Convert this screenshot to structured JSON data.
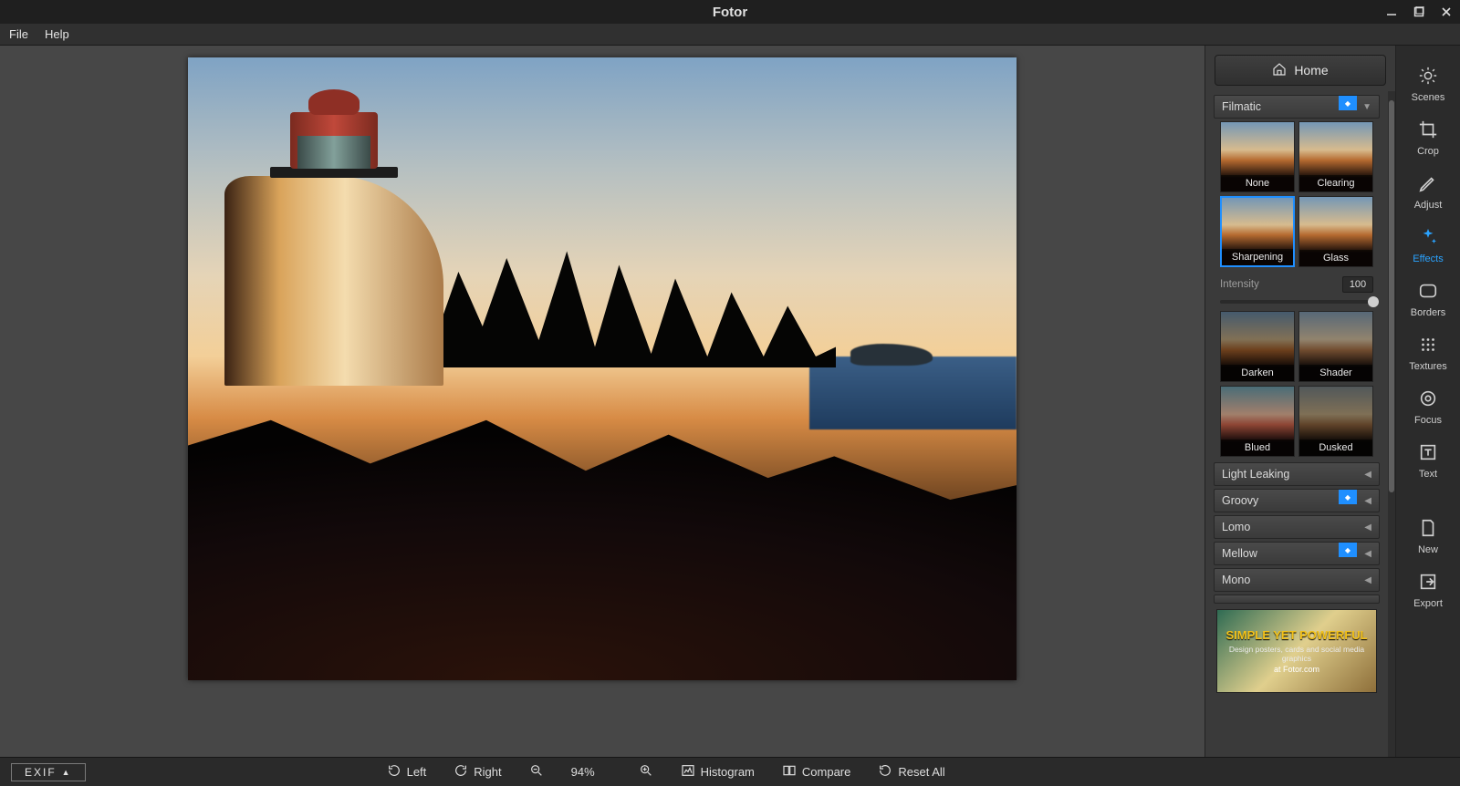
{
  "app_title": "Fotor",
  "menu": {
    "file": "File",
    "help": "Help"
  },
  "home_label": "Home",
  "rail": {
    "scenes": "Scenes",
    "crop": "Crop",
    "adjust": "Adjust",
    "effects": "Effects",
    "borders": "Borders",
    "textures": "Textures",
    "focus": "Focus",
    "text": "Text",
    "new": "New",
    "export": "Export"
  },
  "panel": {
    "active_category": "Filmatic",
    "intensity_label": "Intensity",
    "intensity_value": "100",
    "effects": {
      "none": "None",
      "clearing": "Clearing",
      "sharpening": "Sharpening",
      "glass": "Glass",
      "darken": "Darken",
      "shader": "Shader",
      "blued": "Blued",
      "dusked": "Dusked"
    },
    "categories": {
      "light_leaking": "Light Leaking",
      "groovy": "Groovy",
      "lomo": "Lomo",
      "mellow": "Mellow",
      "mono": "Mono"
    }
  },
  "promo": {
    "title": "SIMPLE YET POWERFUL",
    "subtitle": "Design posters, cards and social media graphics",
    "url": "at Fotor.com"
  },
  "bottom": {
    "exif": "EXIF",
    "left": "Left",
    "right": "Right",
    "zoom": "94%",
    "histogram": "Histogram",
    "compare": "Compare",
    "reset": "Reset  All"
  }
}
